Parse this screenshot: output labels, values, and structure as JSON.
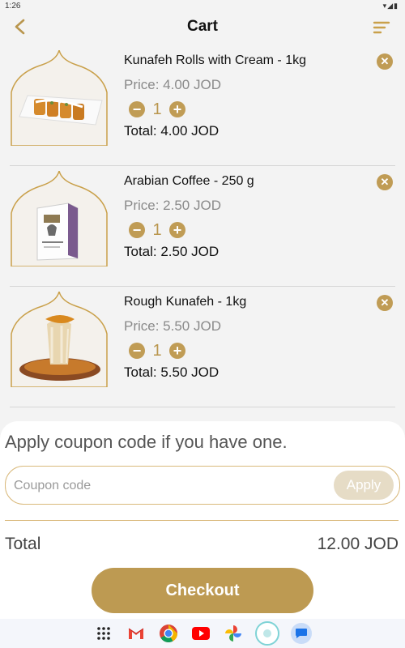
{
  "status": {
    "time": "1:26",
    "icons": "wifi-icon battery-icon"
  },
  "header": {
    "title": "Cart"
  },
  "colors": {
    "accent": "#c09c55",
    "accent_light": "#e6dcc6",
    "price": "#8a8a8a"
  },
  "items": [
    {
      "name": "Kunafeh Rolls with Cream - 1kg",
      "price": "Price: 4.00 JOD",
      "qty": "1",
      "total": "Total: 4.00 JOD"
    },
    {
      "name": "Arabian Coffee - 250 g",
      "price": "Price: 2.50 JOD",
      "qty": "1",
      "total": "Total: 2.50 JOD"
    },
    {
      "name": "Rough Kunafeh - 1kg",
      "price": "Price: 5.50 JOD",
      "qty": "1",
      "total": "Total: 5.50 JOD"
    }
  ],
  "coupon": {
    "title": "Apply coupon code if you have one.",
    "placeholder": "Coupon code",
    "value": "",
    "apply_label": "Apply"
  },
  "summary": {
    "total_label": "Total",
    "total_value": "12.00 JOD"
  },
  "checkout_label": "Checkout",
  "dock": [
    {
      "name": "app-drawer-icon"
    },
    {
      "name": "gmail-icon"
    },
    {
      "name": "chrome-icon"
    },
    {
      "name": "youtube-icon"
    },
    {
      "name": "photos-icon"
    },
    {
      "name": "app-icon"
    },
    {
      "name": "messages-icon"
    }
  ]
}
